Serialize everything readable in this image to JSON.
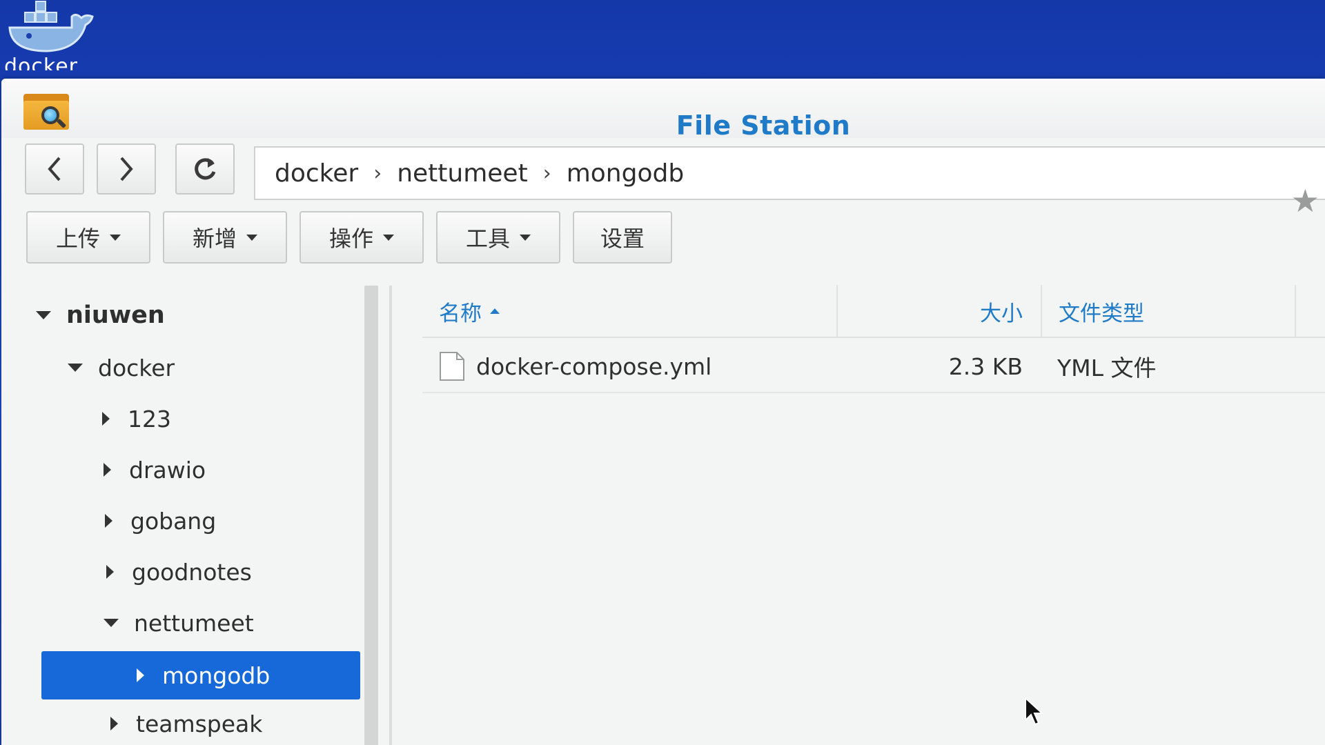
{
  "desktop": {
    "icon_name": "docker-whale-icon",
    "label": "docker"
  },
  "window": {
    "title": "File Station",
    "app_icon": "file-station-icon"
  },
  "nav": {
    "back_icon": "chevron-left-icon",
    "forward_icon": "chevron-right-icon",
    "refresh_icon": "refresh-icon",
    "breadcrumbs": [
      "docker",
      "nettumeet",
      "mongodb"
    ],
    "bookmark_icon": "star-icon"
  },
  "toolbar": {
    "upload": "上传",
    "create": "新增",
    "action": "操作",
    "tools": "工具",
    "settings": "设置"
  },
  "tree": {
    "root": "niuwen",
    "items": [
      {
        "label": "docker",
        "expanded": true
      },
      {
        "label": "123"
      },
      {
        "label": "drawio"
      },
      {
        "label": "gobang"
      },
      {
        "label": "goodnotes"
      },
      {
        "label": "nettumeet",
        "expanded": true
      },
      {
        "label": "mongodb",
        "selected": true
      },
      {
        "label": "teamspeak"
      }
    ]
  },
  "list": {
    "columns": {
      "name": "名称",
      "size": "大小",
      "type": "文件类型"
    },
    "rows": [
      {
        "name": "docker-compose.yml",
        "size": "2.3 KB",
        "type": "YML 文件"
      }
    ]
  },
  "colors": {
    "accent": "#1f7ac8",
    "selection": "#1768d8",
    "desktop_bg": "#1f4bd0"
  }
}
